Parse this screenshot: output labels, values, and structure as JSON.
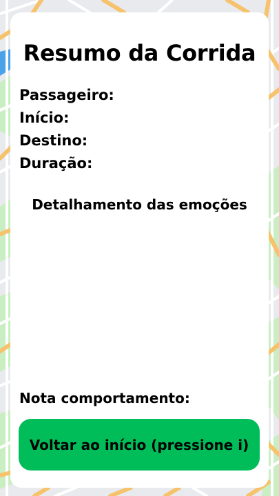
{
  "summary": {
    "title": "Resumo da Corrida",
    "fields": {
      "passenger": "Passageiro:",
      "start": "Início:",
      "destination": "Destino:",
      "duration": "Duração:"
    },
    "emotions_title": "Detalhamento das emoções",
    "behavior_label": "Nota comportamento:",
    "home_button": "Voltar ao início (pressione i)"
  },
  "colors": {
    "button": "#00bd5a",
    "card": "#ffffff",
    "map_base": "#e9ecee",
    "map_park": "#c9eec2",
    "map_road": "#f6c26b",
    "map_street": "#ffffff",
    "map_water": "#4aa3e8"
  }
}
